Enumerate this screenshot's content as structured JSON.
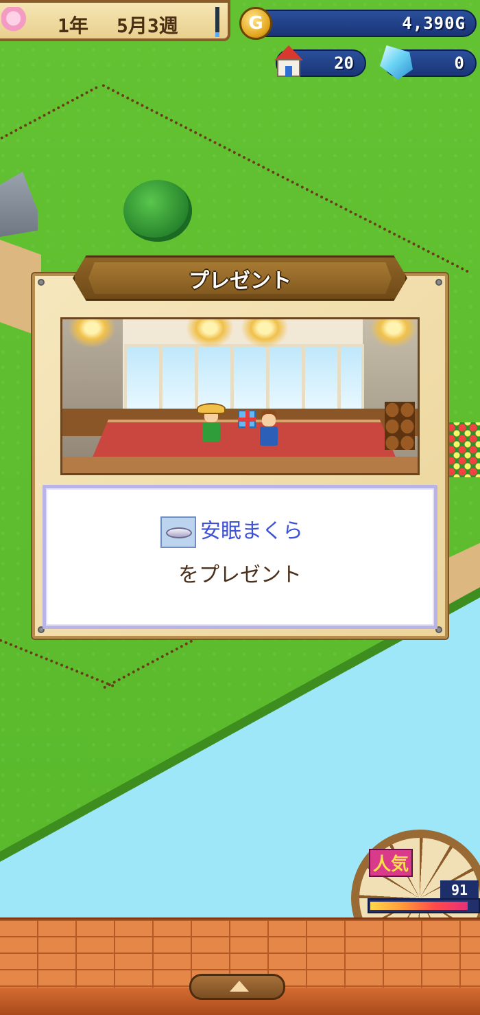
{
  "hud": {
    "year": "1年",
    "date": "5月3週",
    "gold": "4,390G",
    "gold_icon": "G",
    "buildings": "20",
    "crystals": "0",
    "season_progress": 0.15
  },
  "dialog": {
    "title": "プレゼント",
    "item_name": "安眠まくら",
    "message": "をプレゼント"
  },
  "popularity": {
    "label": "人気",
    "value": "91",
    "fill": 0.91
  },
  "icons": {
    "coin": "coin-icon",
    "buildings": "house-icon",
    "crystals": "crystal-icon",
    "item": "pillow-icon",
    "menu": "chevron-up-icon"
  },
  "colors": {
    "grass": "#5fbf2e",
    "river": "#9ee7f8",
    "item_name": "#3e52d8",
    "hud_blue": "#1a3578"
  }
}
